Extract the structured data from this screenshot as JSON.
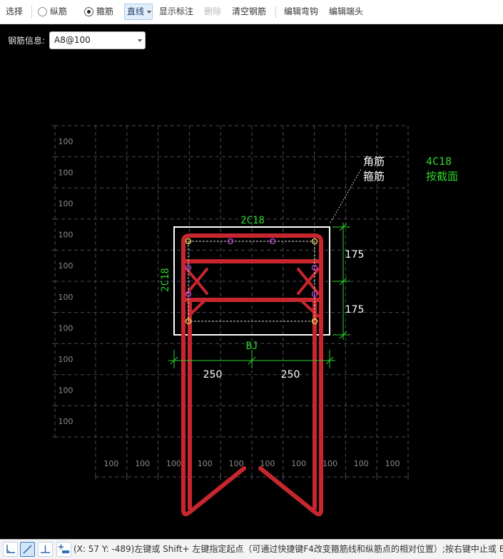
{
  "toolbar": {
    "select": "选择",
    "rebar_type": {
      "longitudinal": {
        "label": "纵筋",
        "checked": false
      },
      "stirrup": {
        "label": "箍筋",
        "checked": true
      }
    },
    "draw_mode": {
      "label": "直线",
      "active": true
    },
    "show_annotation": "显示标注",
    "delete": {
      "label": "删除",
      "enabled": false
    },
    "clear_rebar": "清空钢筋",
    "edit_hook": "编辑弯钩",
    "edit_end": "编辑端头"
  },
  "rebar_info": {
    "label": "钢筋信息:",
    "value": "A8@100"
  },
  "canvas": {
    "grid_left_labels": [
      "100",
      "100",
      "100",
      "100",
      "100",
      "100",
      "100",
      "100",
      "100",
      "100"
    ],
    "grid_bottom_labels": [
      "100",
      "100",
      "100",
      "100",
      "100",
      "100",
      "100",
      "100",
      "100",
      "100"
    ],
    "annotations": {
      "top_rebar": "2C18",
      "side_rebar": "2C18",
      "stirrup_code": "BJ",
      "dim_height_top": "175",
      "dim_height_bottom": "175",
      "dim_width_left": "250",
      "dim_width_right": "250",
      "corner_rebar_label": "角筋",
      "stirrup_label": "箍筋",
      "corner_rebar_value": "4C18",
      "corner_rebar_mode": "按截面"
    },
    "colors": {
      "background": "#000000",
      "grid": "#4a4a5c",
      "grid_label": "#8c8c8c",
      "section_outline": "#ffffff",
      "stirrup": "#c8262e",
      "annotation_green": "#2ed02e",
      "dimension_text": "#ffffff",
      "corner_rebar_point": "#e2cf45",
      "side_rebar_point": "#b43ec8",
      "leader": "#cfcfcf"
    }
  },
  "status_bar": {
    "tools": [
      {
        "icon": "corner-snap-icon",
        "active": false
      },
      {
        "icon": "line-draw-icon",
        "active": true
      },
      {
        "icon": "perpendicular-icon",
        "active": false
      },
      {
        "icon": "add-point-icon",
        "active": false
      }
    ],
    "text": "(X: 57 Y: -489)左键或 Shift+ 左键指定起点（可通过快捷键F4改变箍筋线和纵筋点的相对位置）;按右键中止或 ESC"
  }
}
